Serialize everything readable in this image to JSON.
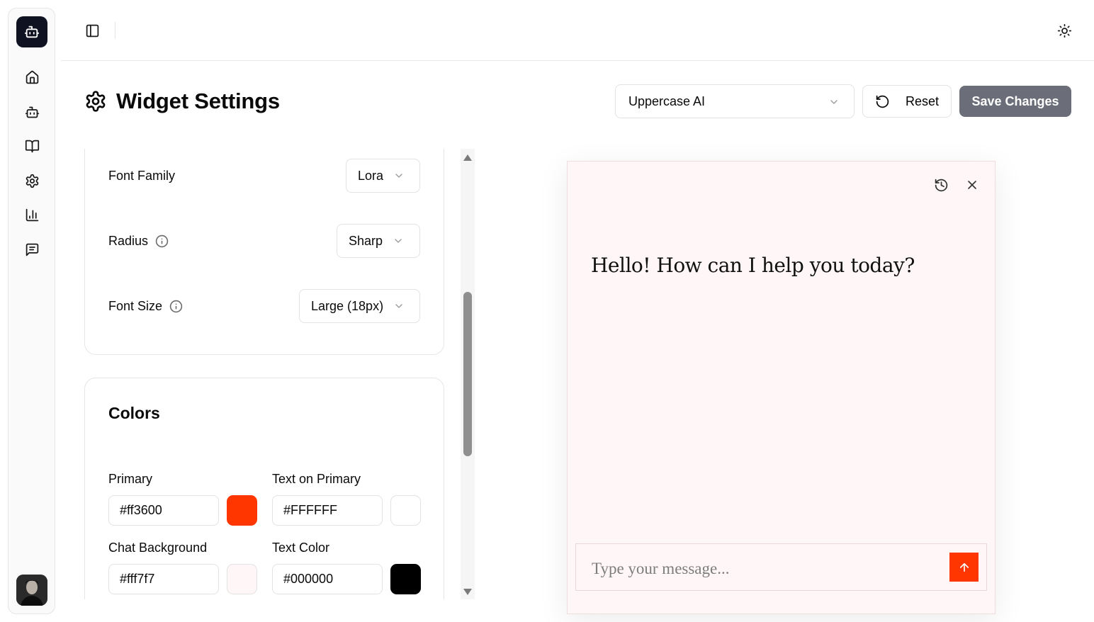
{
  "header": {
    "title": "Widget Settings",
    "bot_select_value": "Uppercase AI",
    "reset_label": "Reset",
    "save_label": "Save Changes"
  },
  "sidebar": {
    "items": [
      {
        "name": "home",
        "icon": "home-icon"
      },
      {
        "name": "bots",
        "icon": "bot-icon"
      },
      {
        "name": "knowledge",
        "icon": "book-icon"
      },
      {
        "name": "settings",
        "icon": "gear-icon"
      },
      {
        "name": "analytics",
        "icon": "bar-chart-icon"
      },
      {
        "name": "conversations",
        "icon": "message-icon"
      }
    ]
  },
  "appearance": {
    "font_family_label": "Font Family",
    "font_family_value": "Lora",
    "radius_label": "Radius",
    "radius_value": "Sharp",
    "font_size_label": "Font Size",
    "font_size_value": "Large (18px)"
  },
  "colors": {
    "title": "Colors",
    "primary_label": "Primary",
    "primary_value": "#ff3600",
    "text_on_primary_label": "Text on Primary",
    "text_on_primary_value": "#FFFFFF",
    "chat_background_label": "Chat Background",
    "chat_background_value": "#fff7f7",
    "text_color_label": "Text Color",
    "text_color_value": "#000000"
  },
  "preview": {
    "greeting": "Hello! How can I help you today?",
    "input_placeholder": "Type your message..."
  },
  "theme": {
    "primary": "#ff3600",
    "chat_background": "#fff7f7",
    "save_button_bg": "#6b6d78",
    "logo_bg": "#0f1221"
  }
}
